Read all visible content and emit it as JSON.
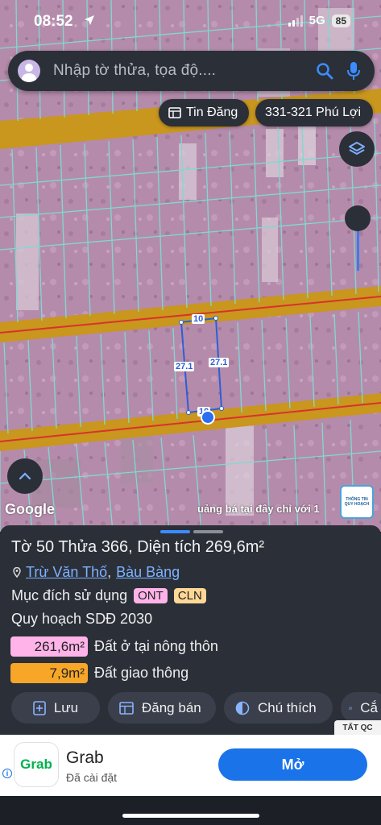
{
  "status_bar": {
    "time": "08:52",
    "network": "5G",
    "battery": "85"
  },
  "search": {
    "placeholder": "Nhập tờ thửa, tọa độ...."
  },
  "chips": {
    "news": "Tin Đăng",
    "address": "331-321 Phú Lợi"
  },
  "map": {
    "dim_top": "10",
    "dim_left": "27.1",
    "dim_right": "27.1",
    "dim_bottom": "10",
    "attribution": "Google",
    "marquee": "uảng bá tại đây chỉ với 1",
    "badge_line1": "THÔNG TIN",
    "badge_line2": "QUY HOẠCH"
  },
  "parcel": {
    "title": "Tờ 50 Thửa 366, Diện tích 269,6m²",
    "ward": "Trừ Văn Thố",
    "district": "Bàu Bàng",
    "separator": ",",
    "purpose_label": "Mục đích sử dụng",
    "purpose_tags": [
      "ONT",
      "CLN"
    ],
    "plan_label": "Quy hoạch SDĐ 2030",
    "land_uses": [
      {
        "area": "261,6m²",
        "label": "Đất ở tại nông thôn",
        "color": "#ffb3e8"
      },
      {
        "area": "7,9m²",
        "label": "Đất giao thông",
        "color": "#f7a628"
      }
    ]
  },
  "actions": {
    "save": "Lưu",
    "sell": "Đăng bán",
    "legend": "Chú thích",
    "capture": "Cắ"
  },
  "ad": {
    "tag": "TẤT QC",
    "info": "i",
    "logo": "Grab",
    "title": "Grab",
    "subtitle": "Đã cài đặt",
    "cta": "Mở"
  },
  "colors": {
    "accent": "#1a73e8",
    "panel": "#2b2f38",
    "parcel_line": "#2b5fd6",
    "road": "#c9961e"
  }
}
